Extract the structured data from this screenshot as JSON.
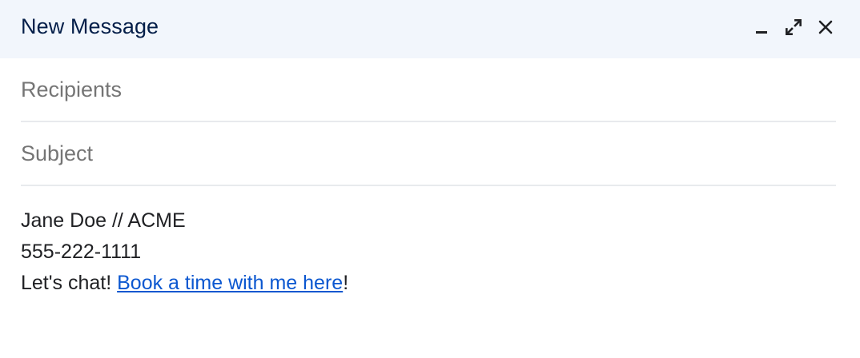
{
  "window": {
    "title": "New Message",
    "icons": {
      "minimize": "minimize-icon",
      "fullscreen": "expand-icon",
      "close": "close-icon"
    }
  },
  "recipients": {
    "value": "",
    "placeholder": "Recipients"
  },
  "subject": {
    "value": "",
    "placeholder": "Subject"
  },
  "signature": {
    "line1": "Jane Doe // ACME",
    "line2": "555-222-1111",
    "line3_prefix": "Let's chat! ",
    "link_text": "Book a time with me here",
    "line3_suffix": "!"
  },
  "colors": {
    "header_bg": "#f2f6fc",
    "title": "#041e49",
    "link": "#0b57d0",
    "divider": "#e8eaed",
    "placeholder": "#757575"
  }
}
